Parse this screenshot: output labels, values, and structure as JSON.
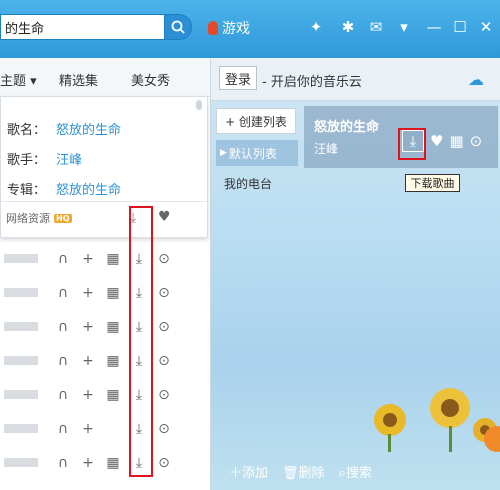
{
  "search": {
    "value": "的生命"
  },
  "topbar": {
    "game_label": "游戏"
  },
  "left": {
    "tabs": [
      "主题",
      "精选集",
      "美女秀"
    ],
    "popup": {
      "song_label": "歌名：",
      "song_value": "怒放的生命",
      "artist_label": "歌手：",
      "artist_value": "汪峰",
      "album_label": "专辑：",
      "album_value": "怒放的生命",
      "net_resource": "网络资源",
      "hq_badge": "HQ"
    }
  },
  "right": {
    "login": "登录",
    "slogan": "- 开启你的音乐云",
    "create_list": "+ 创建列表",
    "default_list": "默认列表",
    "my_radio": "我的电台",
    "now_playing": {
      "title": "怒放的生命",
      "artist": "汪峰"
    },
    "tooltip": "下载歌曲",
    "bottom": {
      "add": "添加",
      "delete": "删除",
      "search": "搜索"
    }
  },
  "icons": {
    "search": "search-icon",
    "game": "game-icon",
    "download": "download-icon",
    "heart": "heart-icon",
    "mv": "mv-icon",
    "more": "more-icon"
  },
  "colors": {
    "accent": "#2f98d8",
    "link": "#2a93d6",
    "highlight": "#e0141e"
  }
}
